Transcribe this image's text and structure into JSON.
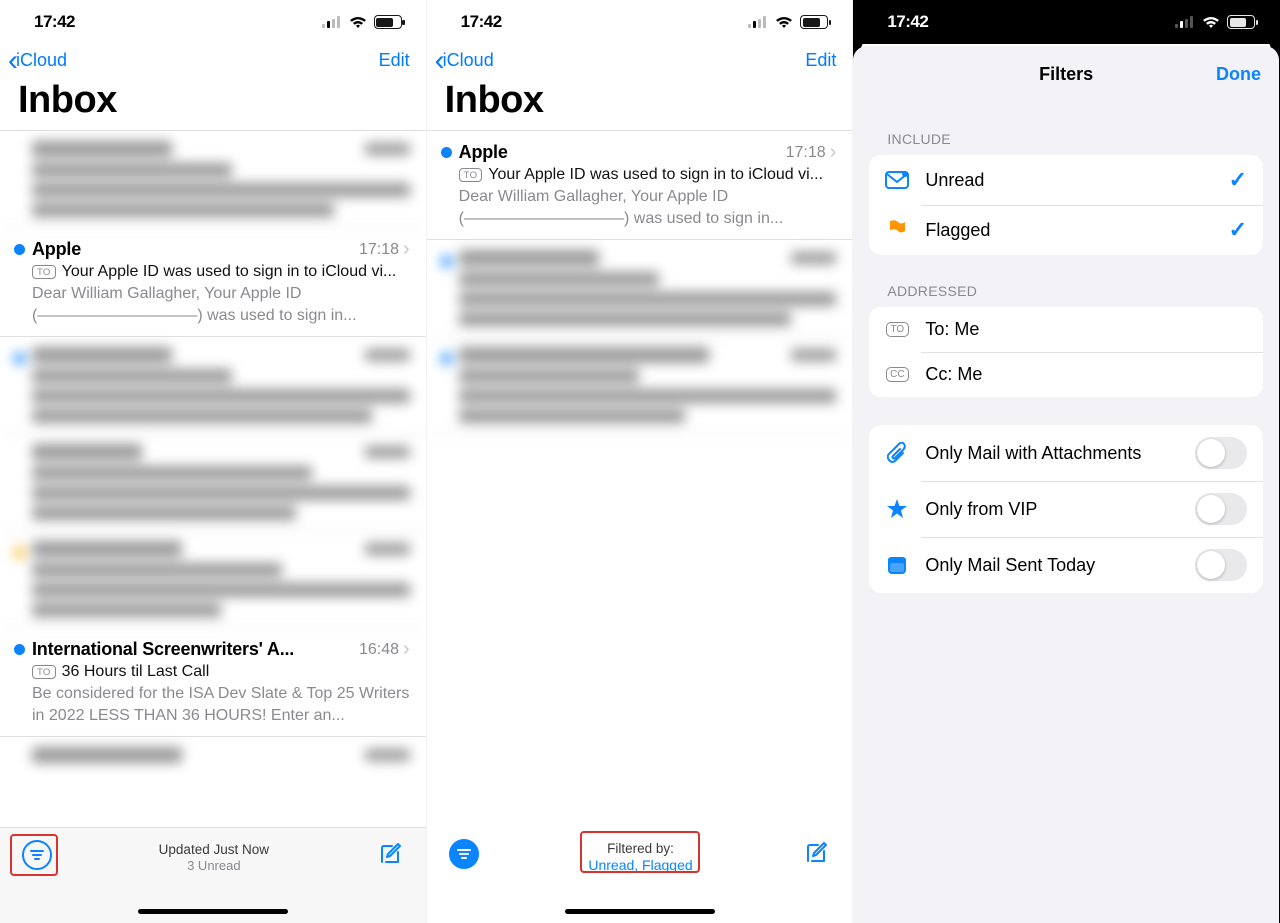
{
  "status": {
    "time": "17:42"
  },
  "colors": {
    "tint": "#007aff",
    "red": "#d9332f",
    "orange": "#ff9500"
  },
  "pane1": {
    "back": "iCloud",
    "edit": "Edit",
    "title": "Inbox",
    "items": [
      {
        "blurred": true
      },
      {
        "unread": true,
        "sender": "Apple",
        "time": "17:18",
        "subject": "Your Apple ID was used to sign in to iCloud vi...",
        "preview": "Dear William Gallagher, Your Apple ID (——————————) was used to sign in..."
      },
      {
        "blurred": true,
        "unread": true
      },
      {
        "blurred": true
      },
      {
        "blurred": true,
        "flagged": true
      },
      {
        "unread": true,
        "sender": "International Screenwriters' A...",
        "time": "16:48",
        "subject": "36 Hours til Last Call",
        "preview": "Be considered for the ISA Dev Slate & Top 25 Writers in 2022 LESS THAN 36 HOURS! Enter an..."
      },
      {
        "blurred": true
      }
    ],
    "toolbar": {
      "line1": "Updated Just Now",
      "line2": "3 Unread"
    }
  },
  "pane2": {
    "back": "iCloud",
    "edit": "Edit",
    "title": "Inbox",
    "items": [
      {
        "unread": true,
        "sender": "Apple",
        "time": "17:18",
        "subject": "Your Apple ID was used to sign in to iCloud vi...",
        "preview": "Dear William Gallagher, Your Apple ID (——————————) was used to sign in..."
      },
      {
        "blurred": true,
        "unread": true
      },
      {
        "blurred": true,
        "unread": true
      }
    ],
    "toolbar": {
      "line1": "Filtered by:",
      "line2": "Unread, Flagged"
    }
  },
  "pane3": {
    "title": "Filters",
    "done": "Done",
    "sections": {
      "include": {
        "label": "INCLUDE",
        "rows": [
          {
            "icon": "mail",
            "label": "Unread",
            "checked": true
          },
          {
            "icon": "flag",
            "label": "Flagged",
            "checked": true
          }
        ]
      },
      "addressed": {
        "label": "ADDRESSED",
        "rows": [
          {
            "icon": "to",
            "label": "To: Me"
          },
          {
            "icon": "cc",
            "label": "Cc: Me"
          }
        ]
      },
      "other": {
        "rows": [
          {
            "icon": "clip",
            "label": "Only Mail with Attachments",
            "toggle": false
          },
          {
            "icon": "star",
            "label": "Only from VIP",
            "toggle": false
          },
          {
            "icon": "cal",
            "label": "Only Mail Sent Today",
            "toggle": false
          }
        ]
      }
    }
  }
}
